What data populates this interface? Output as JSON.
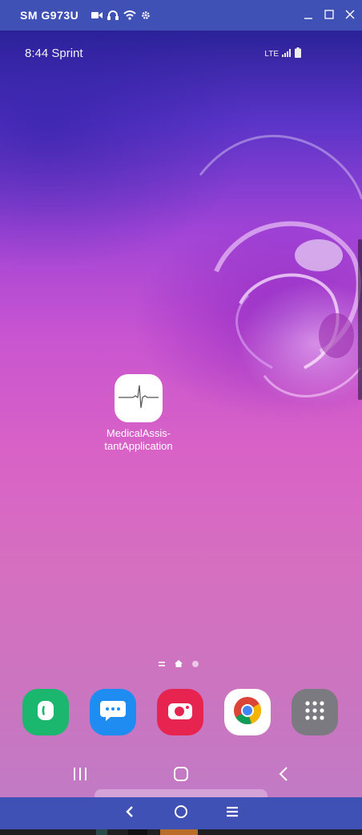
{
  "window": {
    "device_name": "SM G973U",
    "title_icons": [
      "video-camera-icon",
      "headphones-icon",
      "wifi-icon",
      "gear-icon"
    ],
    "controls": [
      "minimize-icon",
      "maximize-icon",
      "close-icon"
    ],
    "bar_color": "#3f51b5"
  },
  "statusbar": {
    "time_carrier": "8:44 Sprint",
    "network": "LTE",
    "icons": [
      "signal-icon",
      "battery-icon"
    ]
  },
  "home": {
    "apps": [
      {
        "name_line1": "MedicalAssis-",
        "name_line2": "tantApplication",
        "icon": "heartbeat-icon"
      }
    ],
    "page_indicator": {
      "pages": 3,
      "current": 2
    }
  },
  "dock": {
    "apps": [
      {
        "icon": "phone-icon",
        "color": "#1bb76e"
      },
      {
        "icon": "messages-icon",
        "color": "#1e8cf0"
      },
      {
        "icon": "camera-icon",
        "color": "#e7234f"
      },
      {
        "icon": "chrome-icon",
        "color": "#ffffff"
      },
      {
        "icon": "apps-grid-icon",
        "color": "#7a7a80"
      }
    ]
  },
  "navbar": {
    "icons": [
      "recents-icon",
      "home-icon",
      "back-icon"
    ]
  },
  "emulator_bar": {
    "icons": [
      "back-icon",
      "home-icon",
      "menu-icon"
    ]
  }
}
